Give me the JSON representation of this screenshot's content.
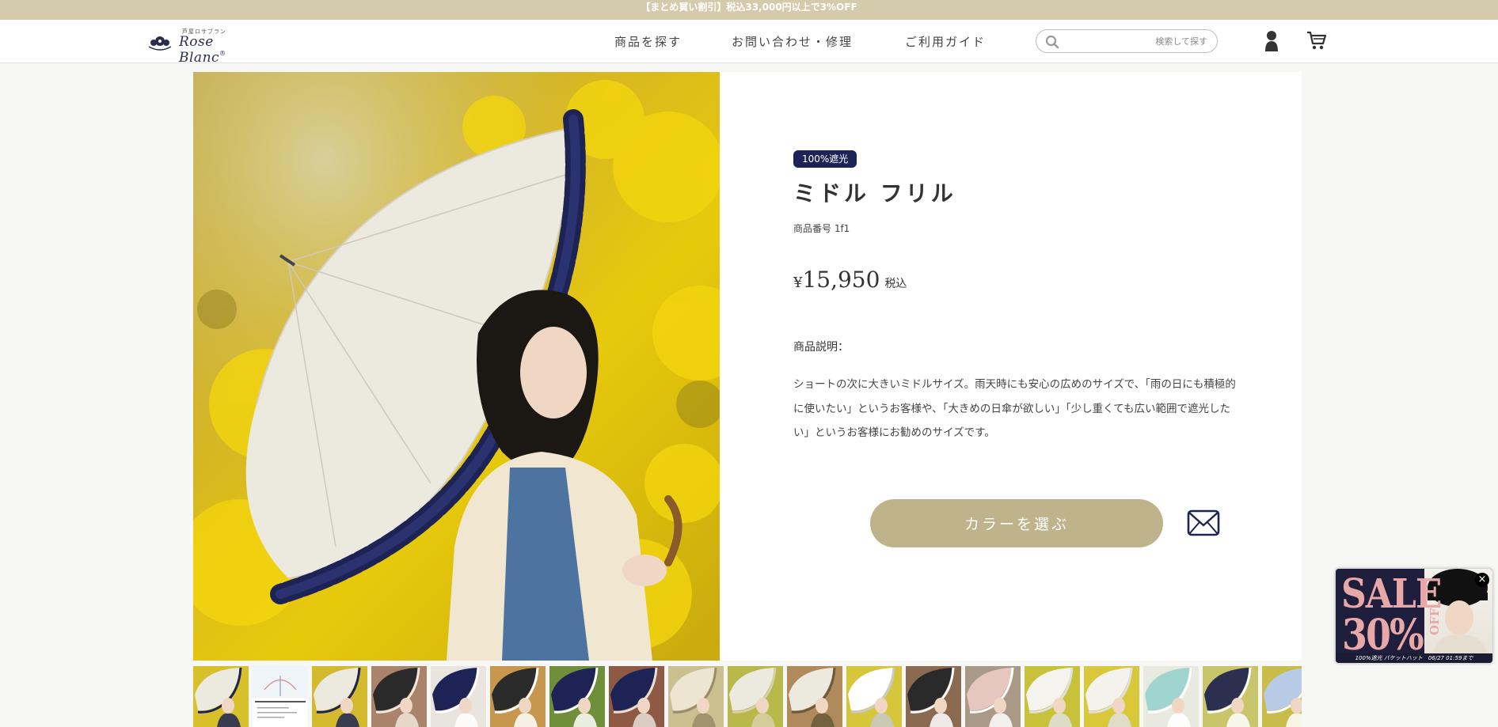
{
  "announcement": "【まとめ買い割引】税込33,000円以上で3%OFF",
  "brand": {
    "logo_small": "芦屋ロサブラン",
    "logo_main": "Rose Blanc",
    "logo_mark": "®"
  },
  "nav": {
    "items": [
      {
        "label": "商品を探す"
      },
      {
        "label": "お問い合わせ・修理"
      },
      {
        "label": "ご利用ガイド"
      }
    ]
  },
  "search": {
    "placeholder": "検索して探す",
    "value": ""
  },
  "header_icons": [
    "search-icon",
    "account-icon",
    "cart-icon"
  ],
  "product": {
    "badge": "100%遮光",
    "title": "ミドル フリル",
    "sku": "商品番号 1f1",
    "price_symbol": "¥",
    "price": "15,950",
    "tax_label": "税込",
    "description_label": "商品説明：",
    "description": "ショートの次に大きいミドルサイズ。雨天時にも安心の広めのサイズで、「雨の日にも積極的に使いたい」というお客様や、「大きめの日傘が欲しい」「少し重くても広い範囲で遮光したい」というお客様にお勧めのサイズです。",
    "color_button": "カラーを選ぶ",
    "contact_icon": "mail-icon"
  },
  "thumbnails": {
    "count": 19,
    "selected_index": 0
  },
  "promo": {
    "sale": "SALE",
    "percent": "30%",
    "off": "OFF",
    "caption": "100%遮光 バケットハット　06/27 01:59まで",
    "close": "×"
  },
  "colors": {
    "announcement_bg": "#d4cbac",
    "badge_bg": "#1d2455",
    "button_bg": "#beb38b",
    "promo_bg": "#1f1f3d",
    "promo_text": "#e8a8a8"
  }
}
